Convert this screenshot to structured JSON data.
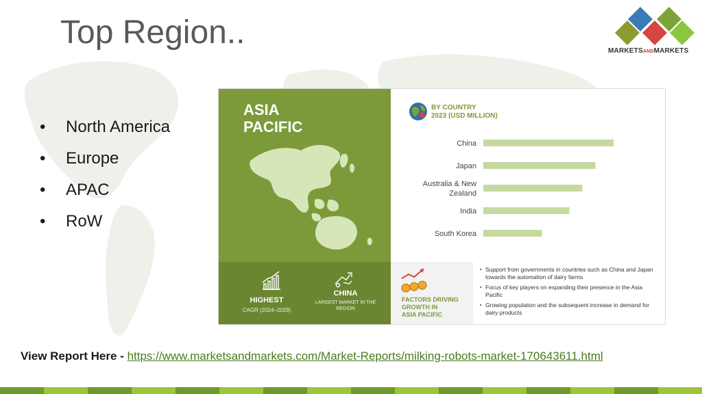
{
  "slide": {
    "title": "Top Region.."
  },
  "logo": {
    "text_main": "MARKETS",
    "text_and": "AND",
    "text_end": "MARKETS",
    "colors": [
      "#3a7bb8",
      "#7aa437",
      "#d64541",
      "#8cc63f"
    ]
  },
  "bullets": [
    "North America",
    "Europe",
    "APAC",
    "RoW"
  ],
  "infographic": {
    "region_line1": "ASIA",
    "region_line2": "PACIFIC",
    "stat_highest": "HIGHEST",
    "stat_cagr": "CAGR (2024–2029)",
    "stat_china": "CHINA",
    "stat_china_sub1": "LARGEST MARKET IN THE",
    "stat_china_sub2": "REGION",
    "chart_title_line1": "BY COUNTRY",
    "chart_title_line2": "2023 (USD MILLION)",
    "factors_title_line1": "FACTORS DRIVING",
    "factors_title_line2": "GROWTH IN",
    "factors_title_line3": "ASIA PACIFIC",
    "factors": [
      "Support from governments in countries such as China and Japan towards the automation of dairy farms",
      "Focus of key players on expanding their presence in the Asia Pacific",
      "Growing population and the subsequent increase in demand for dairy products"
    ],
    "accent_color": "#7c9a3a",
    "bar_color": "#c5d9a0"
  },
  "chart_data": {
    "type": "bar",
    "orientation": "horizontal",
    "title": "BY COUNTRY 2023 (USD MILLION)",
    "categories": [
      "China",
      "Japan",
      "Australia & New Zealand",
      "India",
      "South Korea"
    ],
    "category_lines": [
      [
        "China"
      ],
      [
        "Japan"
      ],
      [
        "Australia & New",
        "Zealand"
      ],
      [
        "India"
      ],
      [
        "South Korea"
      ]
    ],
    "values": [
      100,
      86,
      76,
      66,
      45
    ],
    "value_axis_shown": false,
    "grid": false
  },
  "footer": {
    "label": "View Report Here - ",
    "url": "https://www.marketsandmarkets.com/Market-Reports/milking-robots-market-170643611.html",
    "bar_colors": [
      "#6e9a2c",
      "#9cc43c"
    ]
  }
}
